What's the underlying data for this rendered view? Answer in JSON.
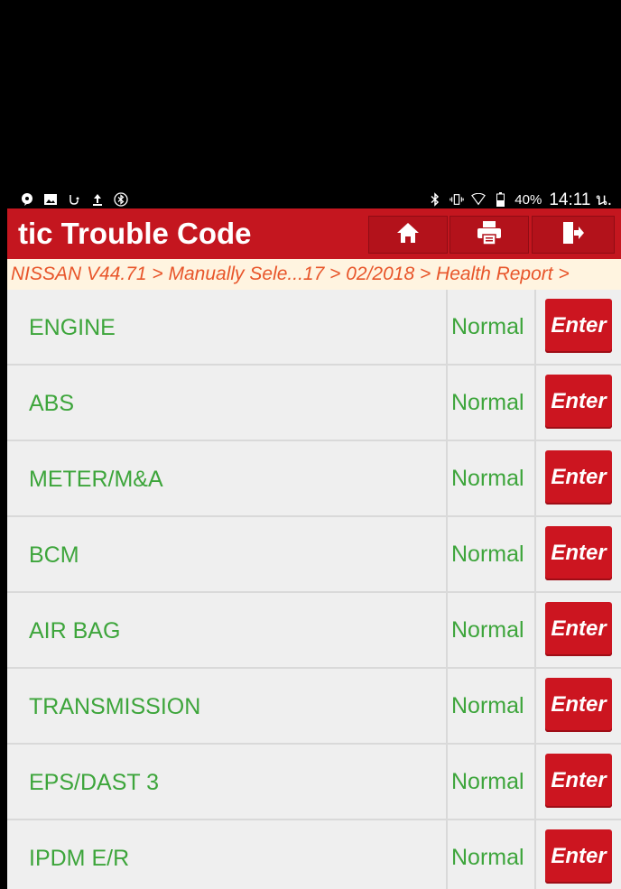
{
  "status_bar": {
    "battery": "40%",
    "time": "14:11 น.",
    "left_icons": [
      "chat-icon",
      "image-icon",
      "usb-debug-icon",
      "upload-icon",
      "bluetooth-circle-icon"
    ],
    "right_icons": [
      "bluetooth-icon",
      "vibrate-icon",
      "wifi-icon",
      "battery-icon"
    ]
  },
  "header": {
    "title": "tic Trouble Code",
    "home_icon": "home-icon",
    "print_icon": "print-icon",
    "exit_icon": "exit-icon",
    "bg_color": "#c4161f"
  },
  "breadcrumb": "NISSAN V44.71 > Manually Sele...17 > 02/2018 > Health Report >",
  "modules": [
    {
      "name": "ENGINE",
      "status": "Normal",
      "button": "Enter"
    },
    {
      "name": "ABS",
      "status": "Normal",
      "button": "Enter"
    },
    {
      "name": "METER/M&A",
      "status": "Normal",
      "button": "Enter"
    },
    {
      "name": "BCM",
      "status": "Normal",
      "button": "Enter"
    },
    {
      "name": "AIR BAG",
      "status": "Normal",
      "button": "Enter"
    },
    {
      "name": "TRANSMISSION",
      "status": "Normal",
      "button": "Enter"
    },
    {
      "name": "EPS/DAST 3",
      "status": "Normal",
      "button": "Enter"
    },
    {
      "name": "IPDM E/R",
      "status": "Normal",
      "button": "Enter"
    }
  ],
  "colors": {
    "status_text": "#3da53b",
    "enter_button": "#cc1520",
    "breadcrumb_text": "#e8552a"
  }
}
